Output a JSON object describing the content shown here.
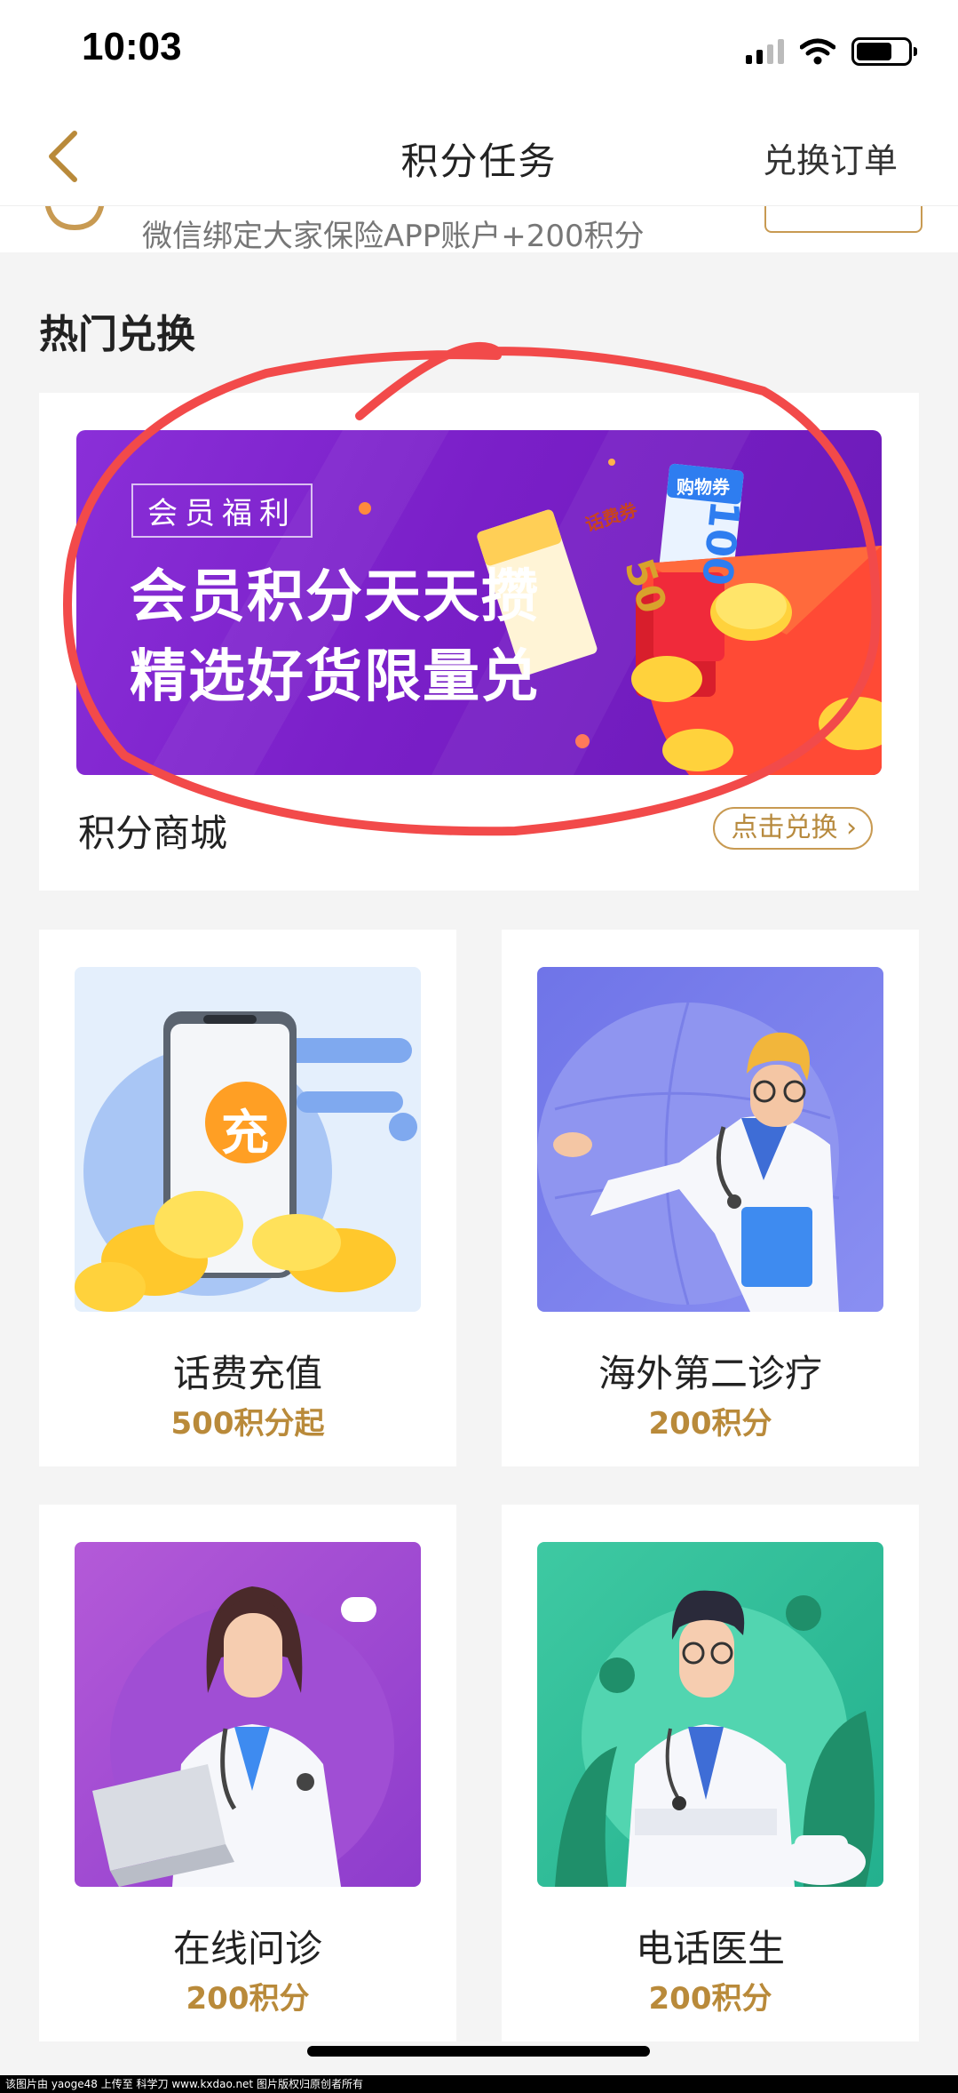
{
  "status_bar": {
    "time": "10:03"
  },
  "nav": {
    "title": "积分任务",
    "right_link": "兑换订单"
  },
  "task_strip": {
    "text": "微信绑定大家保险APP账户+200积分"
  },
  "section": {
    "title": "热门兑换"
  },
  "mall": {
    "banner_tag": "会员福利",
    "banner_line1": "会员积分天天攒",
    "banner_line2": "精选好货限量兑",
    "coupon_1": "话费券",
    "coupon_1_value": "50",
    "coupon_2": "购物券",
    "coupon_2_value": "100",
    "label": "积分商城",
    "button": "点击兑换"
  },
  "cards": [
    {
      "title": "话费充值",
      "points": "500积分起",
      "icon_text": "充"
    },
    {
      "title": "海外第二诊疗",
      "points": "200积分"
    },
    {
      "title": "在线问诊",
      "points": "200积分"
    },
    {
      "title": "电话医生",
      "points": "200积分"
    }
  ],
  "watermark": "该图片由 yaoge48 上传至 科学刀 www.kxdao.net 图片版权归原创者所有",
  "colors": {
    "accent": "#b98a3a",
    "banner": "#7a1fc8",
    "annotation": "#f24a4a"
  }
}
